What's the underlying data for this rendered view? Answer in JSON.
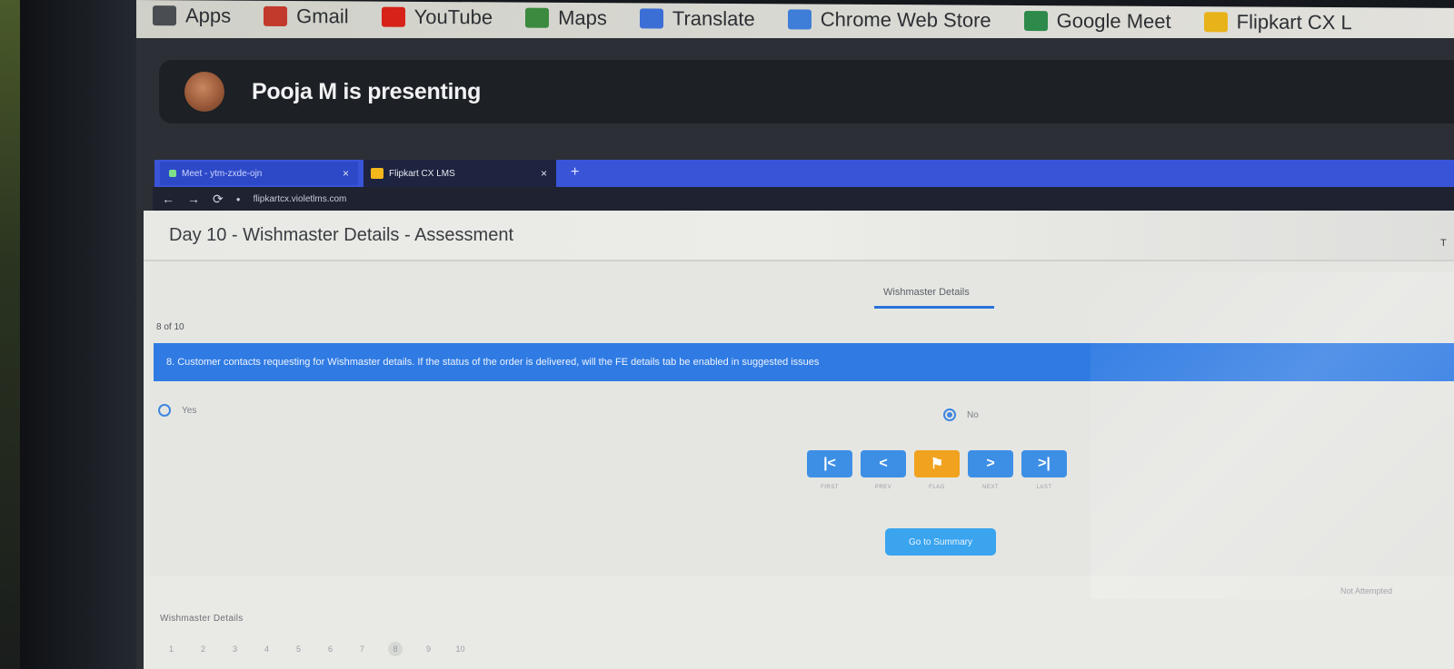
{
  "bookmarks": [
    {
      "label": "Apps",
      "icon": "apps-grid-icon",
      "color": "#4a4d52"
    },
    {
      "label": "Gmail",
      "icon": "gmail-icon",
      "color": "#c23a2b"
    },
    {
      "label": "YouTube",
      "icon": "youtube-icon",
      "color": "#d62218"
    },
    {
      "label": "Maps",
      "icon": "maps-icon",
      "color": "#3b8a3f"
    },
    {
      "label": "Translate",
      "icon": "translate-icon",
      "color": "#3b6fd6"
    },
    {
      "label": "Chrome Web Store",
      "icon": "chrome-web-store-icon",
      "color": "#3f7ed8"
    },
    {
      "label": "Google Meet",
      "icon": "google-meet-icon",
      "color": "#2d8a4a"
    },
    {
      "label": "Flipkart CX L",
      "icon": "flipkart-icon",
      "color": "#e8b319"
    }
  ],
  "presenter": {
    "name": "Pooja M is presenting"
  },
  "shared_browser": {
    "tab1_label": "Meet - ytm-zxde-ojn",
    "tab2_label": "Flipkart CX LMS",
    "tab_close": "×",
    "new_tab": "+",
    "url": "flipkartcx.violetlms.com"
  },
  "page": {
    "title": "Day 10 - Wishmaster Details - Assessment",
    "corner_text": "T",
    "section_tab": "Wishmaster Details",
    "counter": "8 of 10",
    "question": "8. Customer contacts requesting for Wishmaster details. If the status of the order is delivered, will the FE details tab be enabled in suggested issues",
    "options": [
      {
        "label": "Yes",
        "selected": false
      },
      {
        "label": "No",
        "selected": true
      }
    ],
    "nav": [
      {
        "symbol": "|<",
        "label": "FIRST",
        "color": "#3d8fe6"
      },
      {
        "symbol": "<",
        "label": "PREV",
        "color": "#3d8fe6"
      },
      {
        "symbol": "⚑",
        "label": "FLAG",
        "color": "#f1a21f"
      },
      {
        "symbol": ">",
        "label": "NEXT",
        "color": "#3d8fe6"
      },
      {
        "symbol": ">|",
        "label": "LAST",
        "color": "#3d8fe6"
      }
    ],
    "summary_button": "Go to Summary",
    "legend": "Not Attempted",
    "footer_title": "Wishmaster Details",
    "question_numbers": [
      "1",
      "2",
      "3",
      "4",
      "5",
      "6",
      "7",
      "8",
      "9",
      "10"
    ],
    "current_question": "8"
  }
}
